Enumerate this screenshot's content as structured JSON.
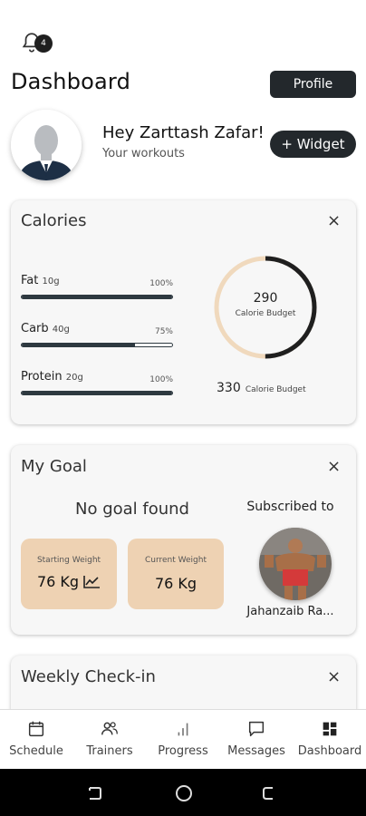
{
  "header": {
    "notification_count": "4",
    "title": "Dashboard",
    "profile_label": "Profile"
  },
  "user": {
    "greeting": "Hey Zarttash Zafar!",
    "subtitle": "Your workouts",
    "widget_label": "+ Widget"
  },
  "calories": {
    "title": "Calories",
    "close_label": "×",
    "macros": [
      {
        "name": "Fat",
        "amount": "10g",
        "percent_label": "100%",
        "fill": 1.0
      },
      {
        "name": "Carb",
        "amount": "40g",
        "percent_label": "75%",
        "fill": 0.75
      },
      {
        "name": "Protein",
        "amount": "20g",
        "percent_label": "100%",
        "fill": 1.0
      }
    ],
    "ring_value": "290",
    "ring_label": "Calorie Budget",
    "ring_fraction": 0.5,
    "budget_value": "330",
    "budget_label": "Calorie Budget"
  },
  "goal": {
    "title": "My Goal",
    "close_label": "×",
    "empty_text": "No goal found",
    "starting_label": "Starting Weight",
    "starting_value": "76 Kg",
    "current_label": "Current Weight",
    "current_value": "76 Kg",
    "subscribed_label": "Subscribed to",
    "trainer_name": "Jahanzaib Ra..."
  },
  "weekly": {
    "title": "Weekly Check-in",
    "close_label": "×"
  },
  "nav": {
    "items": [
      {
        "label": "Schedule",
        "icon": "calendar-icon"
      },
      {
        "label": "Trainers",
        "icon": "users-icon"
      },
      {
        "label": "Progress",
        "icon": "bar-chart-icon"
      },
      {
        "label": "Messages",
        "icon": "message-icon"
      },
      {
        "label": "Dashboard",
        "icon": "dashboard-icon"
      }
    ]
  },
  "colors": {
    "accent_dark": "#23282c",
    "weight_box": "#eed2b3",
    "ring_track": "#f0d9bd"
  }
}
